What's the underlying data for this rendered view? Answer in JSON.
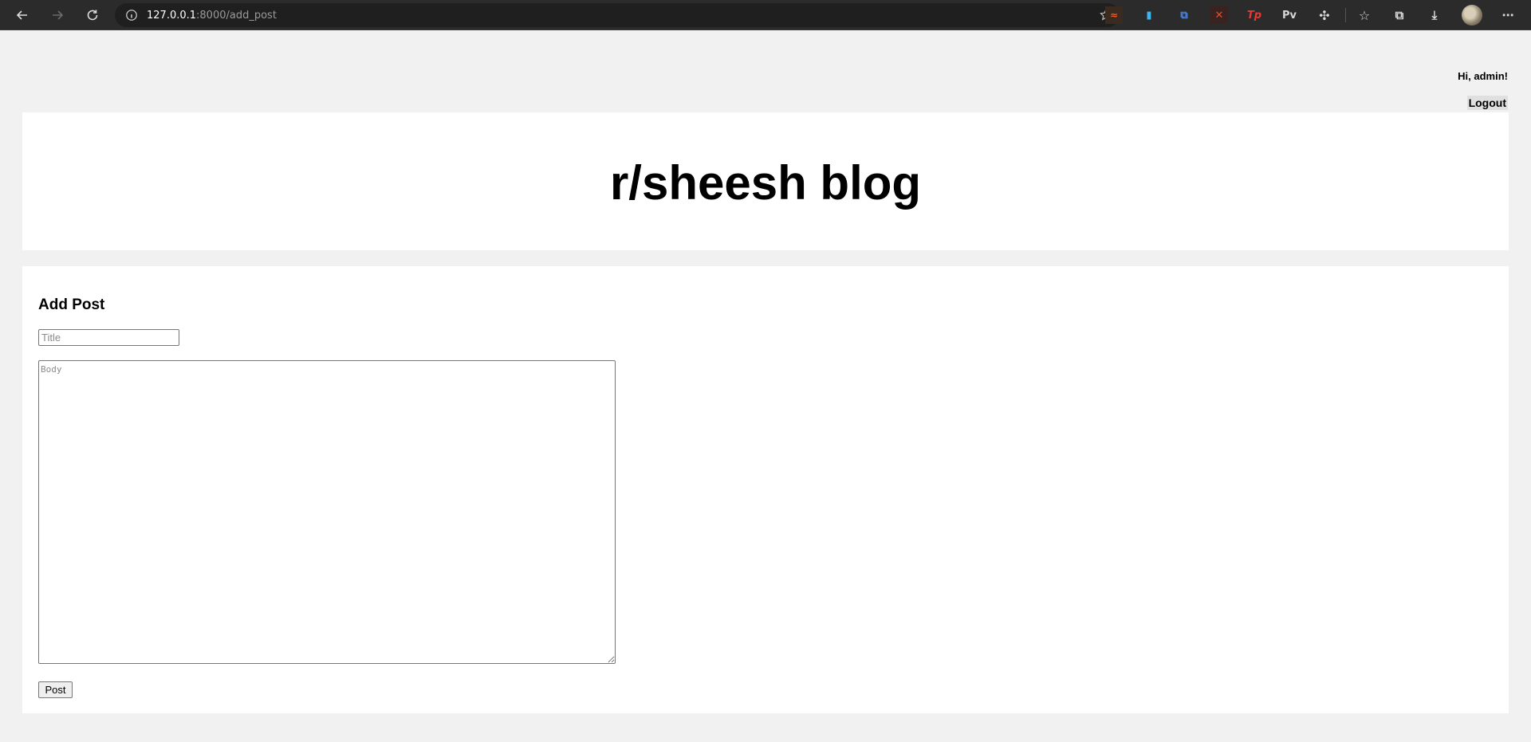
{
  "browser": {
    "url_host": "127.0.0.1",
    "url_rest": ":8000/add_post",
    "extensions": [
      {
        "name": "ext-1-icon",
        "color": "#f05a28",
        "glyph": "≈"
      },
      {
        "name": "ext-2-icon",
        "color": "#3bb4f2",
        "glyph": "▮"
      },
      {
        "name": "ext-translate-icon",
        "color": "#4a86e8",
        "glyph": "⧉"
      },
      {
        "name": "ext-4-icon",
        "color": "#e0522b",
        "glyph": "✕"
      },
      {
        "name": "ext-tp-icon",
        "color": "#e53935",
        "glyph": "Tp"
      },
      {
        "name": "ext-pv-icon",
        "color": "#d6d6d6",
        "glyph": "Pv"
      }
    ]
  },
  "user": {
    "greeting": "Hi, admin!",
    "logout_label": "Logout"
  },
  "site": {
    "title": "r/sheesh blog"
  },
  "form": {
    "heading": "Add Post",
    "title_placeholder": "Title",
    "body_placeholder": "Body",
    "submit_label": "Post"
  }
}
